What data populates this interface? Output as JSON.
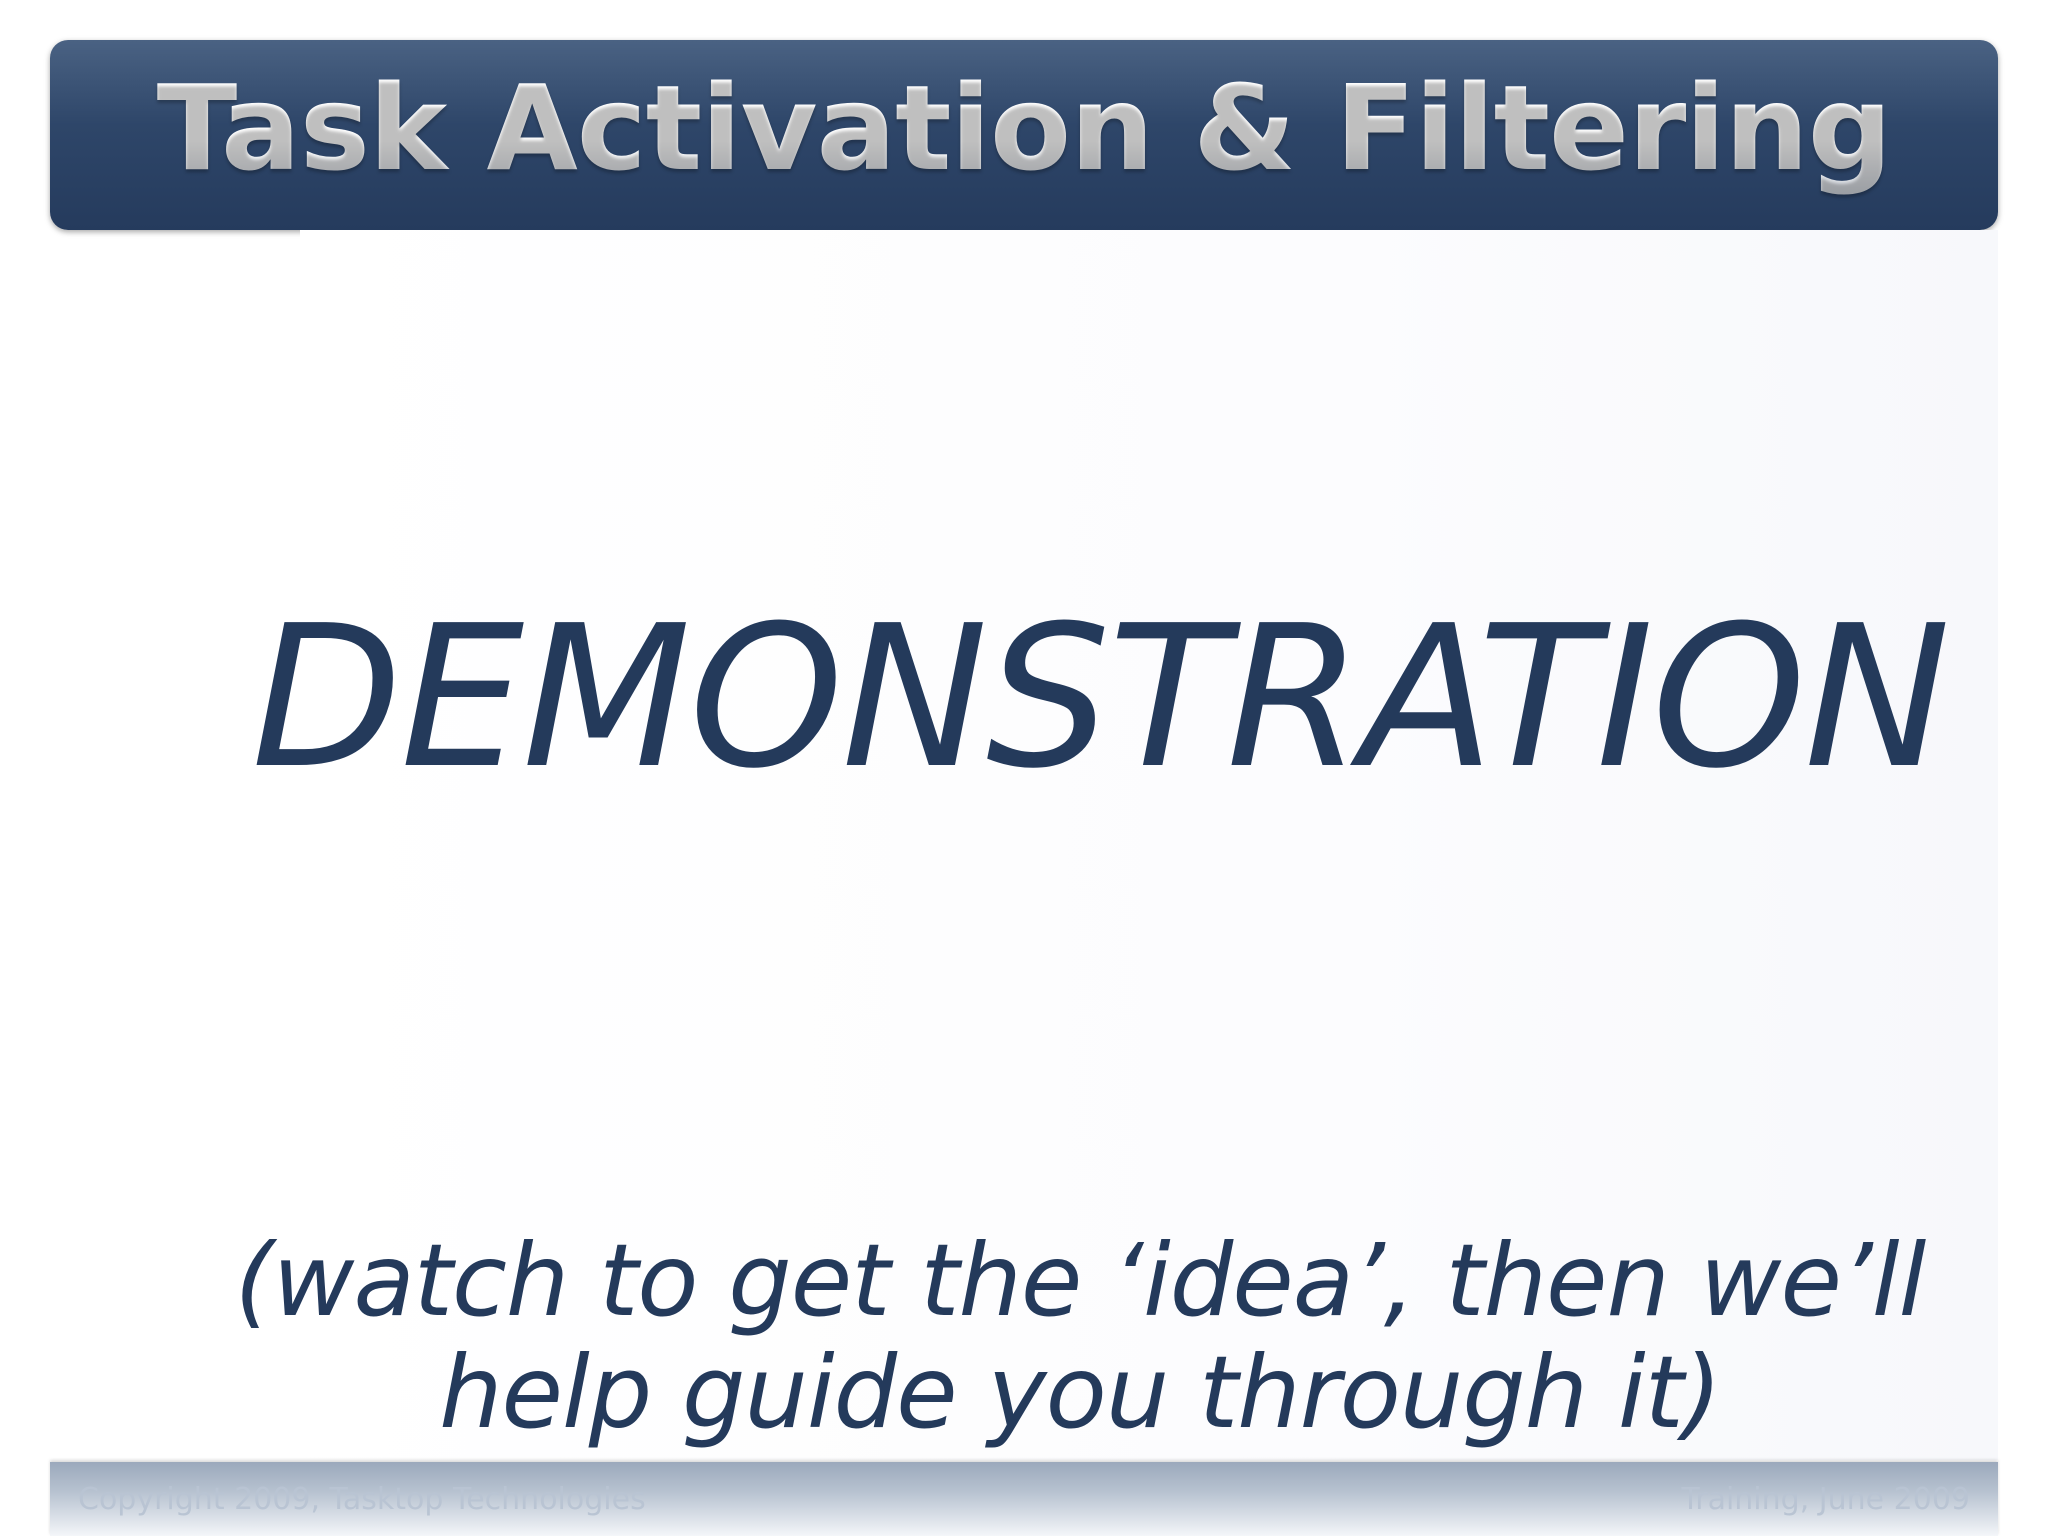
{
  "slide": {
    "title": "Task Activation & Filtering",
    "heading": "DEMONSTRATION",
    "subtitle_line1": "(watch to get the ‘idea’, then we’ll",
    "subtitle_line2": "help guide you through it)"
  },
  "footer": {
    "left": "Copyright 2009, Tasktop Technologies",
    "right": "Training, June 2009"
  },
  "colors": {
    "title_bar": "#2e4669",
    "heading_text": "#243a5b",
    "footer_bar": "#9ba9bc"
  }
}
